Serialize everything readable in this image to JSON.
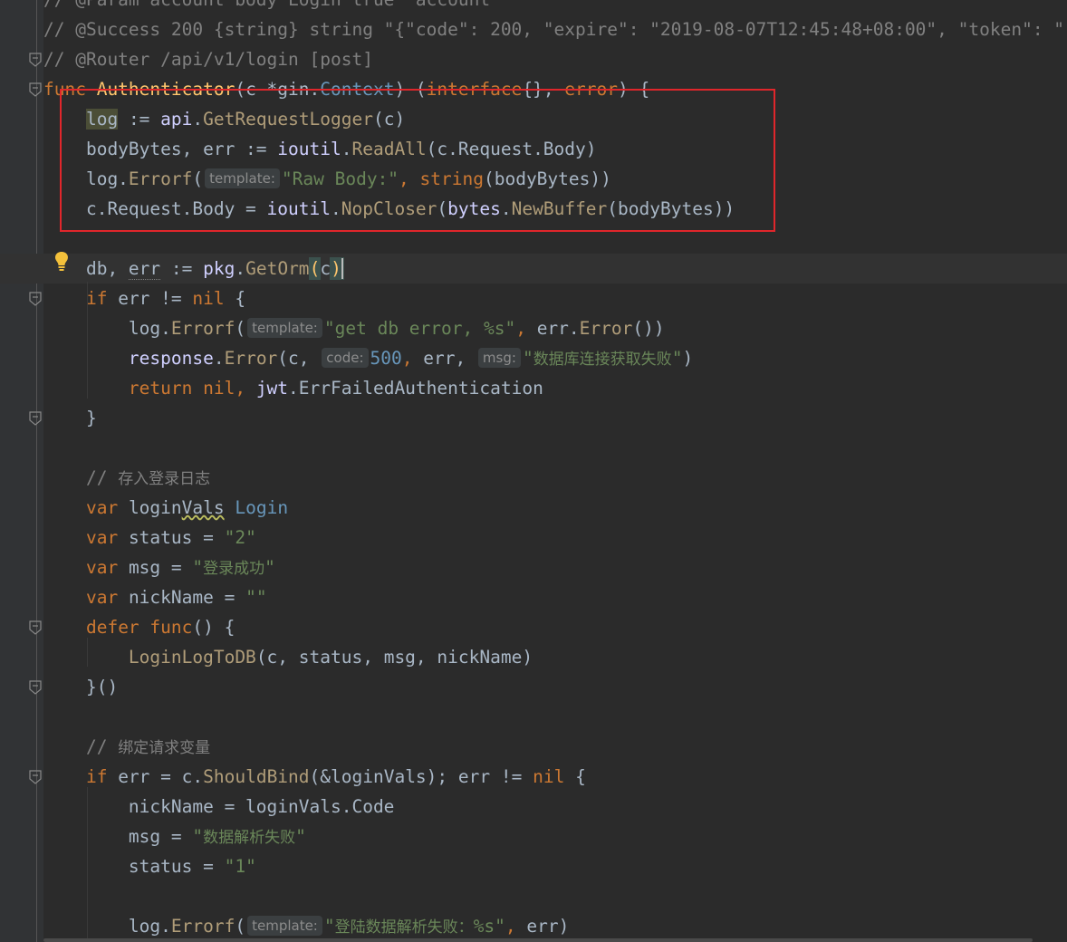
{
  "editor": {
    "lines": [
      {
        "tokens": [
          {
            "t": "// @Param account body Login true \"account\"",
            "c": "tok-cm"
          }
        ]
      },
      {
        "tokens": [
          {
            "t": "// @Success 200 {string} string \"{\"code\": 200, \"expire\": \"2019-08-07T12:45:48+08:00\", \"token\": \"",
            "c": "tok-cm"
          }
        ]
      },
      {
        "tokens": [
          {
            "t": "// @Router /api/v1/login [post]",
            "c": "tok-cm"
          }
        ]
      },
      {
        "tokens": [
          {
            "t": "func ",
            "c": "tok-kw"
          },
          {
            "t": "Authenticator",
            "c": "tok-fn"
          },
          {
            "t": "(c *gin.",
            "c": "tok-pl"
          },
          {
            "t": "Context",
            "c": "tok-type"
          },
          {
            "t": ") (",
            "c": "tok-pl"
          },
          {
            "t": "interface",
            "c": "tok-kw"
          },
          {
            "t": "{}, ",
            "c": "tok-pl"
          },
          {
            "t": "error",
            "c": "tok-kw"
          },
          {
            "t": ") {",
            "c": "tok-pl"
          }
        ]
      },
      {
        "tokens": [
          {
            "t": "    ",
            "c": "tok-pl"
          },
          {
            "t": "log",
            "c": "tok-pl tok-hl"
          },
          {
            "t": " := ",
            "c": "tok-pl"
          },
          {
            "t": "api",
            "c": "tok-pkg"
          },
          {
            "t": ".",
            "c": "tok-pl"
          },
          {
            "t": "GetRequestLogger",
            "c": "tok-mfn"
          },
          {
            "t": "(c)",
            "c": "tok-pl"
          }
        ]
      },
      {
        "tokens": [
          {
            "t": "    bodyBytes, err := ",
            "c": "tok-pl"
          },
          {
            "t": "ioutil",
            "c": "tok-pkg"
          },
          {
            "t": ".",
            "c": "tok-pl"
          },
          {
            "t": "ReadAll",
            "c": "tok-mfn"
          },
          {
            "t": "(c.Request.Body)",
            "c": "tok-pl"
          }
        ]
      },
      {
        "tokens": [
          {
            "t": "    log.",
            "c": "tok-pl"
          },
          {
            "t": "Errorf",
            "c": "tok-mfn"
          },
          {
            "t": "(",
            "c": "tok-pl"
          },
          {
            "t": "template:",
            "c": "tok-hint"
          },
          {
            "t": "\"Raw Body:\"",
            "c": "tok-str"
          },
          {
            "t": ", ",
            "c": "tok-kw"
          },
          {
            "t": "string",
            "c": "tok-kw"
          },
          {
            "t": "(bodyBytes))",
            "c": "tok-pl"
          }
        ]
      },
      {
        "tokens": [
          {
            "t": "    c.Request.Body = ",
            "c": "tok-pl"
          },
          {
            "t": "ioutil",
            "c": "tok-pkg"
          },
          {
            "t": ".",
            "c": "tok-pl"
          },
          {
            "t": "NopCloser",
            "c": "tok-mfn"
          },
          {
            "t": "(",
            "c": "tok-pl"
          },
          {
            "t": "bytes",
            "c": "tok-pkg"
          },
          {
            "t": ".",
            "c": "tok-pl"
          },
          {
            "t": "NewBuffer",
            "c": "tok-mfn"
          },
          {
            "t": "(bodyBytes))",
            "c": "tok-pl"
          }
        ]
      },
      {
        "tokens": []
      },
      {
        "current": true,
        "tokens": [
          {
            "t": "    db, ",
            "c": "tok-pl"
          },
          {
            "t": "err",
            "c": "tok-pl tok-underline"
          },
          {
            "t": " := ",
            "c": "tok-pl"
          },
          {
            "t": "pkg",
            "c": "tok-pkg"
          },
          {
            "t": ".",
            "c": "tok-pl"
          },
          {
            "t": "GetOrm",
            "c": "tok-mfn"
          },
          {
            "t": "(",
            "c": "tok-fn tok-brace"
          },
          {
            "t": "c",
            "c": "tok-pl"
          },
          {
            "t": ")",
            "c": "tok-fn tok-brace tok-caret"
          }
        ]
      },
      {
        "tokens": [
          {
            "t": "    ",
            "c": "tok-pl"
          },
          {
            "t": "if ",
            "c": "tok-kw"
          },
          {
            "t": "err != ",
            "c": "tok-pl"
          },
          {
            "t": "nil ",
            "c": "tok-kw"
          },
          {
            "t": "{",
            "c": "tok-pl"
          }
        ]
      },
      {
        "tokens": [
          {
            "t": "        log.",
            "c": "tok-pl"
          },
          {
            "t": "Errorf",
            "c": "tok-mfn"
          },
          {
            "t": "(",
            "c": "tok-pl"
          },
          {
            "t": "template:",
            "c": "tok-hint"
          },
          {
            "t": "\"get db error, %s\"",
            "c": "tok-str"
          },
          {
            "t": ", ",
            "c": "tok-kw"
          },
          {
            "t": "err.",
            "c": "tok-pl"
          },
          {
            "t": "Error",
            "c": "tok-mfn"
          },
          {
            "t": "())",
            "c": "tok-pl"
          }
        ]
      },
      {
        "tokens": [
          {
            "t": "        ",
            "c": "tok-pl"
          },
          {
            "t": "response",
            "c": "tok-pkg"
          },
          {
            "t": ".",
            "c": "tok-pl"
          },
          {
            "t": "Error",
            "c": "tok-mfn"
          },
          {
            "t": "(c, ",
            "c": "tok-pl"
          },
          {
            "t": "code:",
            "c": "tok-hint"
          },
          {
            "t": "500",
            "c": "tok-num"
          },
          {
            "t": ", ",
            "c": "tok-kw"
          },
          {
            "t": "err, ",
            "c": "tok-pl"
          },
          {
            "t": "msg:",
            "c": "tok-hint"
          },
          {
            "t": "\"",
            "c": "tok-str"
          },
          {
            "t": "数据库连接获取失败",
            "c": "tok-strzh"
          },
          {
            "t": "\"",
            "c": "tok-str"
          },
          {
            "t": ")",
            "c": "tok-pl"
          }
        ]
      },
      {
        "tokens": [
          {
            "t": "        ",
            "c": "tok-pl"
          },
          {
            "t": "return nil, ",
            "c": "tok-kw"
          },
          {
            "t": "jwt",
            "c": "tok-pkg"
          },
          {
            "t": ".ErrFailedAuthentication",
            "c": "tok-pl"
          }
        ]
      },
      {
        "tokens": [
          {
            "t": "    }",
            "c": "tok-pl"
          }
        ]
      },
      {
        "tokens": []
      },
      {
        "tokens": [
          {
            "t": "    // ",
            "c": "tok-cm"
          },
          {
            "t": "存入登录日志",
            "c": "tok-cmzh"
          }
        ]
      },
      {
        "tokens": [
          {
            "t": "    ",
            "c": "tok-pl"
          },
          {
            "t": "var ",
            "c": "tok-kw"
          },
          {
            "t": "login",
            "c": "tok-pl"
          },
          {
            "t": "Vals",
            "c": "tok-pl tok-warn"
          },
          {
            "t": " ",
            "c": "tok-pl"
          },
          {
            "t": "Login",
            "c": "tok-type"
          }
        ]
      },
      {
        "tokens": [
          {
            "t": "    ",
            "c": "tok-pl"
          },
          {
            "t": "var ",
            "c": "tok-kw"
          },
          {
            "t": "status = ",
            "c": "tok-pl"
          },
          {
            "t": "\"2\"",
            "c": "tok-str"
          }
        ]
      },
      {
        "tokens": [
          {
            "t": "    ",
            "c": "tok-pl"
          },
          {
            "t": "var ",
            "c": "tok-kw"
          },
          {
            "t": "msg = ",
            "c": "tok-pl"
          },
          {
            "t": "\"",
            "c": "tok-str"
          },
          {
            "t": "登录成功",
            "c": "tok-strzh"
          },
          {
            "t": "\"",
            "c": "tok-str"
          }
        ]
      },
      {
        "tokens": [
          {
            "t": "    ",
            "c": "tok-pl"
          },
          {
            "t": "var ",
            "c": "tok-kw"
          },
          {
            "t": "nickName = ",
            "c": "tok-pl"
          },
          {
            "t": "\"\"",
            "c": "tok-str"
          }
        ]
      },
      {
        "tokens": [
          {
            "t": "    ",
            "c": "tok-pl"
          },
          {
            "t": "defer ",
            "c": "tok-kw"
          },
          {
            "t": "func",
            "c": "tok-kw"
          },
          {
            "t": "() {",
            "c": "tok-pl"
          }
        ]
      },
      {
        "tokens": [
          {
            "t": "        ",
            "c": "tok-pl"
          },
          {
            "t": "LoginLogToDB",
            "c": "tok-mfn"
          },
          {
            "t": "(c, ",
            "c": "tok-pl"
          },
          {
            "t": "status, ",
            "c": "tok-pl"
          },
          {
            "t": "msg, ",
            "c": "tok-pl"
          },
          {
            "t": "nickName)",
            "c": "tok-pl"
          }
        ]
      },
      {
        "tokens": [
          {
            "t": "    }()",
            "c": "tok-pl"
          }
        ]
      },
      {
        "tokens": []
      },
      {
        "tokens": [
          {
            "t": "    // ",
            "c": "tok-cm"
          },
          {
            "t": "绑定请求变量",
            "c": "tok-cmzh"
          }
        ]
      },
      {
        "tokens": [
          {
            "t": "    ",
            "c": "tok-pl"
          },
          {
            "t": "if ",
            "c": "tok-kw"
          },
          {
            "t": "err = c.",
            "c": "tok-pl"
          },
          {
            "t": "ShouldBind",
            "c": "tok-mfn"
          },
          {
            "t": "(&loginVals); ",
            "c": "tok-pl"
          },
          {
            "t": "err != ",
            "c": "tok-pl"
          },
          {
            "t": "nil ",
            "c": "tok-kw"
          },
          {
            "t": "{",
            "c": "tok-pl"
          }
        ]
      },
      {
        "tokens": [
          {
            "t": "        nickName = loginVals.Code",
            "c": "tok-pl"
          }
        ]
      },
      {
        "tokens": [
          {
            "t": "        msg = ",
            "c": "tok-pl"
          },
          {
            "t": "\"",
            "c": "tok-str"
          },
          {
            "t": "数据解析失败",
            "c": "tok-strzh"
          },
          {
            "t": "\"",
            "c": "tok-str"
          }
        ]
      },
      {
        "tokens": [
          {
            "t": "        status = ",
            "c": "tok-pl"
          },
          {
            "t": "\"1\"",
            "c": "tok-str"
          }
        ]
      },
      {
        "tokens": []
      },
      {
        "tokens": [
          {
            "t": "        log.",
            "c": "tok-pl"
          },
          {
            "t": "Errorf",
            "c": "tok-mfn"
          },
          {
            "t": "(",
            "c": "tok-pl"
          },
          {
            "t": "template:",
            "c": "tok-hint"
          },
          {
            "t": "\"",
            "c": "tok-str"
          },
          {
            "t": "登陆数据解析失败：",
            "c": "tok-strzh"
          },
          {
            "t": "%s\"",
            "c": "tok-str"
          },
          {
            "t": ", ",
            "c": "tok-kw"
          },
          {
            "t": "err)",
            "c": "tok-pl"
          }
        ]
      }
    ]
  },
  "icons": {
    "bulb": "lightbulb-icon",
    "fold": "fold-marker-icon"
  },
  "colors": {
    "background": "#2b2b2b",
    "gutter": "#313335",
    "highlight_box": "#e0262b",
    "keyword": "#cc7832",
    "string": "#6a8759",
    "comment": "#808080",
    "function": "#ffc66d"
  }
}
